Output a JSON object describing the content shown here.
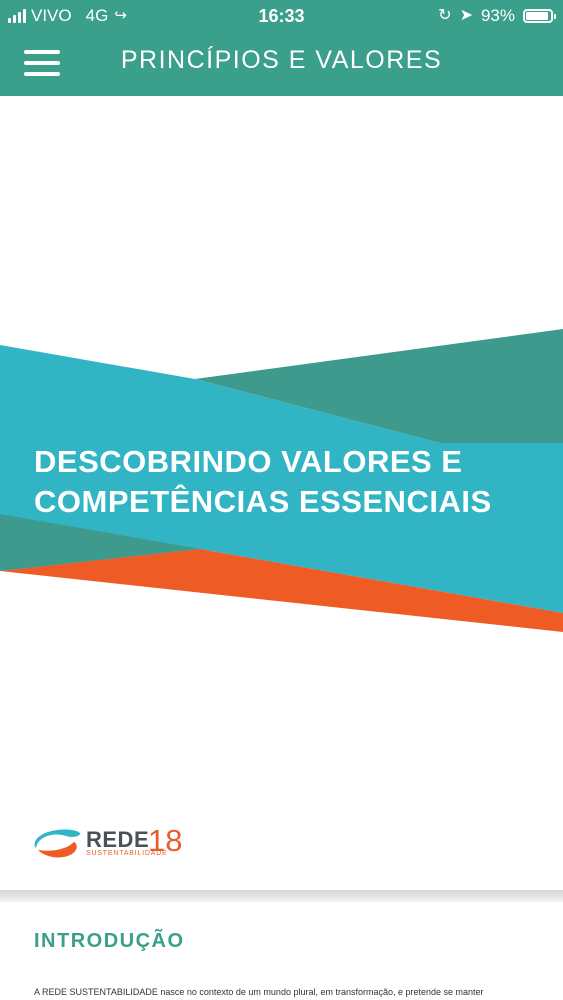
{
  "status_bar": {
    "carrier": "VIVO",
    "network": "4G",
    "time": "16:33",
    "battery": "93%",
    "battery_level": 0.93
  },
  "header": {
    "title": "PRINCÍPIOS E VALORES"
  },
  "cover": {
    "title_line1": "DESCOBRINDO VALORES E",
    "title_line2": "COMPETÊNCIAS ESSENCIAIS"
  },
  "logo": {
    "word": "REDE",
    "subtitle": "SUSTENTABILIDADE",
    "number": "18"
  },
  "section": {
    "title": "INTRODUÇÃO",
    "text": "A REDE SUSTENTABILIDADE nasce no contexto de um mundo plural, em transformação, e pretende se manter"
  },
  "colors": {
    "header": "#3a9f8b",
    "cyan": "#31b4c4",
    "teal_dark": "#3d9a8c",
    "orange": "#ef5b25"
  }
}
